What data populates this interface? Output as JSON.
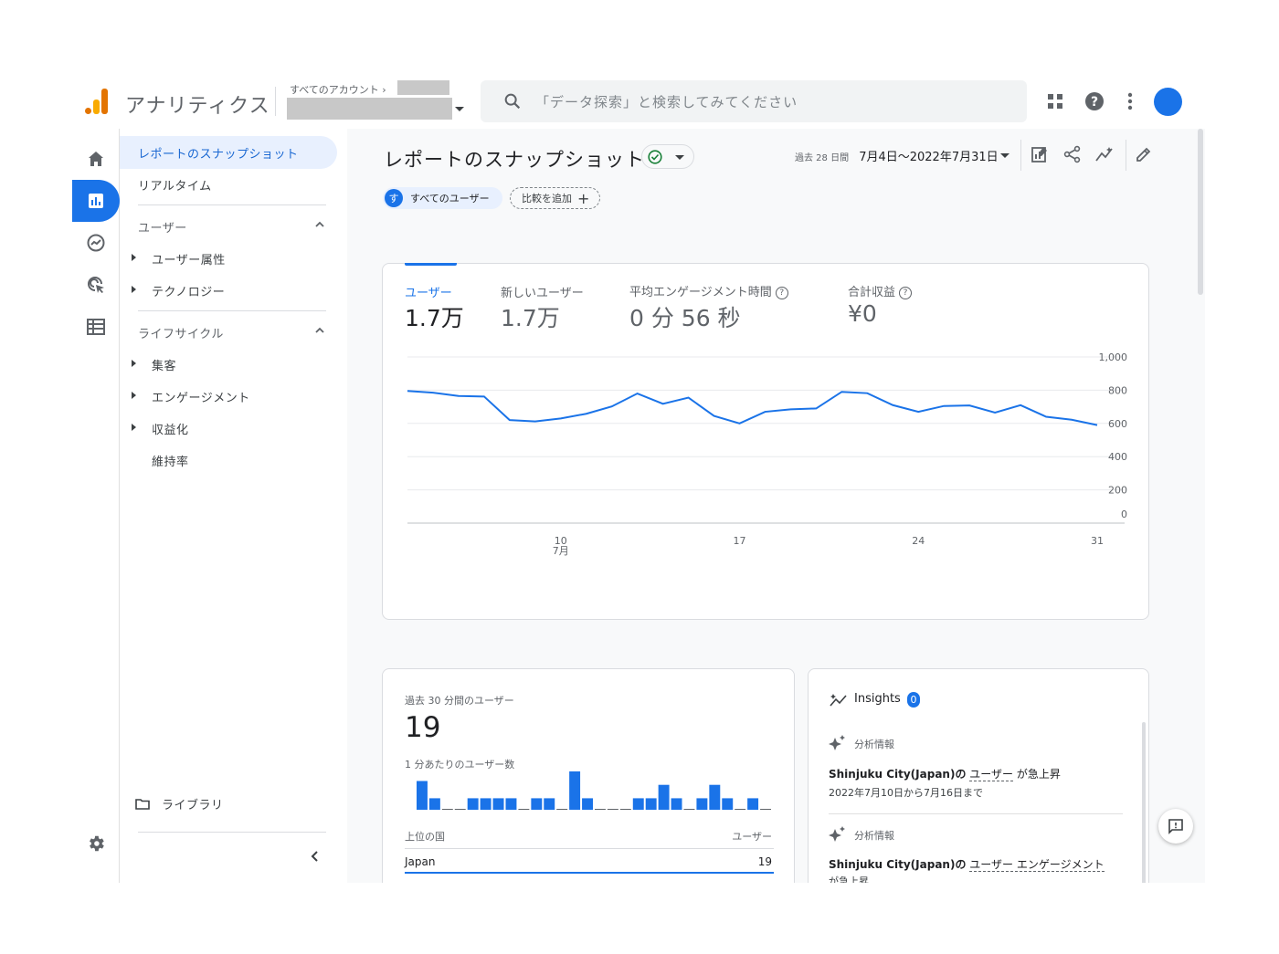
{
  "header": {
    "app_name": "アナリティクス",
    "account_path": "すべてのアカウント",
    "search_placeholder": "「データ探索」と検索してみてください"
  },
  "nav": {
    "items_top": [
      "レポートのスナップショット",
      "リアルタイム"
    ],
    "section_user": "ユーザー",
    "user_items": [
      "ユーザー属性",
      "テクノロジー"
    ],
    "section_lifecycle": "ライフサイクル",
    "lifecycle_items": [
      "集客",
      "エンゲージメント",
      "収益化",
      "維持率"
    ],
    "library": "ライブラリ"
  },
  "page": {
    "title": "レポートのスナップショット",
    "date_prefix": "過去 28 日間",
    "date_range": "7月4日～2022年7月31日",
    "chip_all_users_letter": "す",
    "chip_all_users": "すべてのユーザー",
    "chip_add_compare": "比較を追加"
  },
  "metrics": [
    {
      "label": "ユーザー",
      "value": "1.7万"
    },
    {
      "label": "新しいユーザー",
      "value": "1.7万"
    },
    {
      "label": "平均エンゲージメント時間",
      "value": "0 分 56 秒"
    },
    {
      "label": "合計収益",
      "value": "¥0"
    }
  ],
  "chart_data": {
    "type": "line",
    "series": [
      {
        "values": [
          795,
          785,
          765,
          762,
          620,
          612,
          630,
          658,
          702,
          780,
          718,
          755,
          645,
          600,
          670,
          685,
          690,
          790,
          782,
          710,
          670,
          705,
          708,
          665,
          710,
          640,
          622,
          590
        ]
      }
    ],
    "x": [
      4,
      5,
      6,
      7,
      8,
      9,
      10,
      11,
      12,
      13,
      14,
      15,
      16,
      17,
      18,
      19,
      20,
      21,
      22,
      23,
      24,
      25,
      26,
      27,
      28,
      29,
      30,
      31
    ],
    "x_ticks": [
      {
        "day": 10,
        "label": "10",
        "sub": "7月"
      },
      {
        "day": 17,
        "label": "17",
        "sub": ""
      },
      {
        "day": 24,
        "label": "24",
        "sub": ""
      },
      {
        "day": 31,
        "label": "31",
        "sub": ""
      }
    ],
    "y_ticks": [
      "1,000",
      "800",
      "600",
      "400",
      "200",
      "0"
    ],
    "ylim": [
      0,
      1000
    ],
    "grid": true,
    "color": "#1a73e8"
  },
  "realtime": {
    "title": "過去 30 分間のユーザー",
    "value": "19",
    "per_minute_label": "1 分あたりのユーザー数",
    "bar_values": [
      3,
      1.2,
      0,
      0,
      1.2,
      1.2,
      1.2,
      1.2,
      0,
      1.2,
      1.2,
      0,
      4,
      1.2,
      0,
      0,
      0,
      1.2,
      1.2,
      2.6,
      1.2,
      0,
      1.2,
      2.6,
      1.2,
      0,
      1.2,
      0
    ],
    "country_header": "上位の国",
    "users_header": "ユーザー",
    "country": "Japan",
    "country_value": "19"
  },
  "insights": {
    "title": "Insights",
    "badge": "0",
    "items": [
      {
        "tag": "分析情報",
        "place": "Shinjuku City(Japan)の",
        "metric": "ユーザー",
        "suffix": "が急上昇",
        "date": "2022年7月10日から7月16日まで"
      },
      {
        "tag": "分析情報",
        "place": "Shinjuku City(Japan)の",
        "metric": "ユーザー エンゲージメント",
        "suffix": "",
        "date": "が急上昇"
      }
    ]
  }
}
